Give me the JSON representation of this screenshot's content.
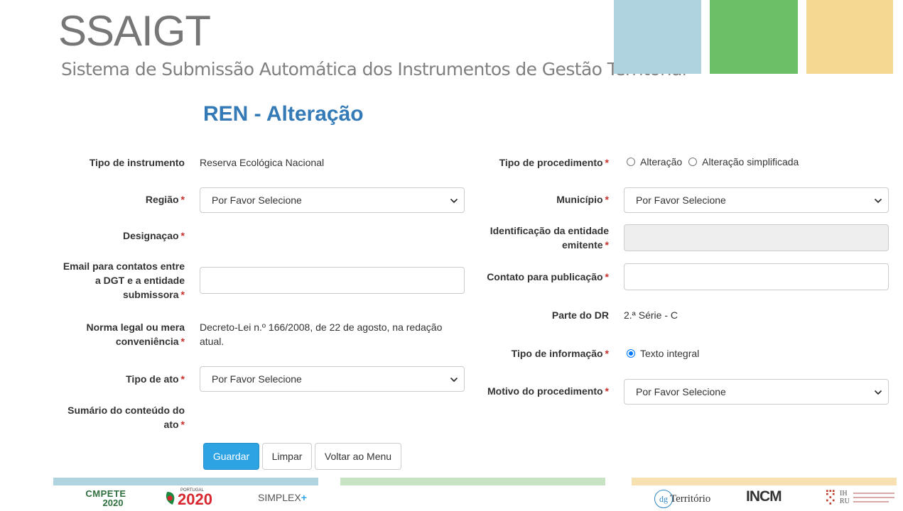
{
  "header": {
    "logo": "SSAIGT",
    "subtitle": "Sistema de  Submissão Automática dos Instrumentos de Gestão Territorial",
    "colors": {
      "blue": "#b0d4df",
      "green": "#6cbf66",
      "yellow": "#f5d891"
    }
  },
  "page_title": "REN - Alteração",
  "form": {
    "tipo_instrumento": {
      "label": "Tipo de instrumento",
      "value": "Reserva Ecológica Nacional"
    },
    "regiao": {
      "label": "Região",
      "value": "Por Favor Selecione"
    },
    "designacao": {
      "label": "Designaçao"
    },
    "email": {
      "label_1": "Email para contatos entre",
      "label_2": "a DGT e a entidade",
      "label_3": "submissora",
      "value": ""
    },
    "norma": {
      "label_1": "Norma legal ou mera",
      "label_2": "conveniência",
      "value_1": "Decreto-Lei n.º 166/2008, de 22 de agosto, na redação",
      "value_2": "atual."
    },
    "tipo_ato": {
      "label": "Tipo de ato",
      "value": "Por Favor Selecione"
    },
    "sumario": {
      "label_1": "Sumário do conteúdo do",
      "label_2": "ato"
    },
    "tipo_procedimento": {
      "label": "Tipo de procedimento",
      "options": [
        "Alteração",
        "Alteração simplificada"
      ]
    },
    "municipio": {
      "label": "Município",
      "value": "Por Favor Selecione"
    },
    "entidade": {
      "label_1": "Identificação da entidade",
      "label_2": "emitente",
      "value": ""
    },
    "contato": {
      "label": "Contato para publicação",
      "value": ""
    },
    "parte_dr": {
      "label": "Parte do DR",
      "value": "2.ª Série - C"
    },
    "tipo_informacao": {
      "label": "Tipo de informação",
      "option": "Texto integral",
      "checked": true
    },
    "motivo": {
      "label": "Motivo do procedimento",
      "value": "Por Favor Selecione"
    },
    "required_mark": "*"
  },
  "buttons": {
    "guardar": "Guardar",
    "limpar": "Limpar",
    "voltar": "Voltar ao Menu"
  },
  "footer": {
    "compete_1": "CMPETE",
    "compete_2": "2020",
    "portugal_small": "PORTUGAL",
    "portugal_big": "2020",
    "simplex": "SIMPLEX",
    "simplex_plus": "+",
    "dgt_1": "dg",
    "dgt_2": "Território",
    "incm": "INCM",
    "ihru": "IHRU"
  }
}
